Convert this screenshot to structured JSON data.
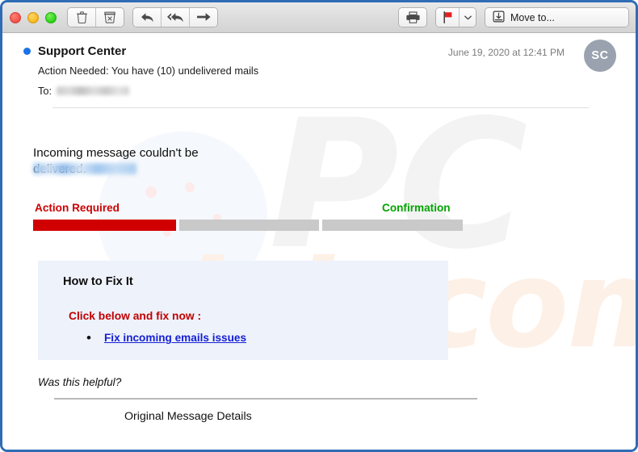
{
  "window": {
    "traffic_lights": [
      {
        "name": "close",
        "color": "#f6524a"
      },
      {
        "name": "minimize",
        "color": "#f9bc1d"
      },
      {
        "name": "zoom",
        "color": "#2bd516"
      }
    ],
    "frame_color": "#2e6cb5"
  },
  "toolbar": {
    "delete_label": "Delete",
    "junk_label": "Junk",
    "reply_label": "Reply",
    "reply_all_label": "Reply All",
    "forward_label": "Forward",
    "print_label": "Print",
    "flag_label": "Flag",
    "flag_color": "#e62020",
    "flag_menu_label": "Flag options",
    "move_to_label": "Move to..."
  },
  "message": {
    "sender": "Support Center",
    "unread": true,
    "subject": "Action Needed: You have (10) undelivered mails",
    "to_label": "To:",
    "to_value_redacted": true,
    "date": "June 19, 2020 at 12:41 PM",
    "avatar_initials": "SC"
  },
  "body": {
    "sender_domain_redacted": true,
    "notice": "Incoming message  couldn't be delivered.",
    "progress": {
      "left_label": "Action Required",
      "left_label_color": "#cc0000",
      "right_label": "Confirmation",
      "right_label_color": "#00a400",
      "steps": [
        {
          "state": "filled",
          "color": "#d10000"
        },
        {
          "state": "empty",
          "color": "#c9c9c9"
        },
        {
          "state": "empty",
          "color": "#c9c9c9"
        }
      ]
    },
    "fix_box": {
      "background": "#eef2fb",
      "title": "How to Fix It",
      "subtitle": "Click below and fix now :",
      "link_text": " Fix incoming emails issues",
      "link_color": "#1520d4"
    },
    "helpful_text": "Was this helpful?",
    "original_message_details": "Original Message Details"
  },
  "watermark": {
    "top_text": "PC",
    "bottom_text": "risk.com"
  }
}
